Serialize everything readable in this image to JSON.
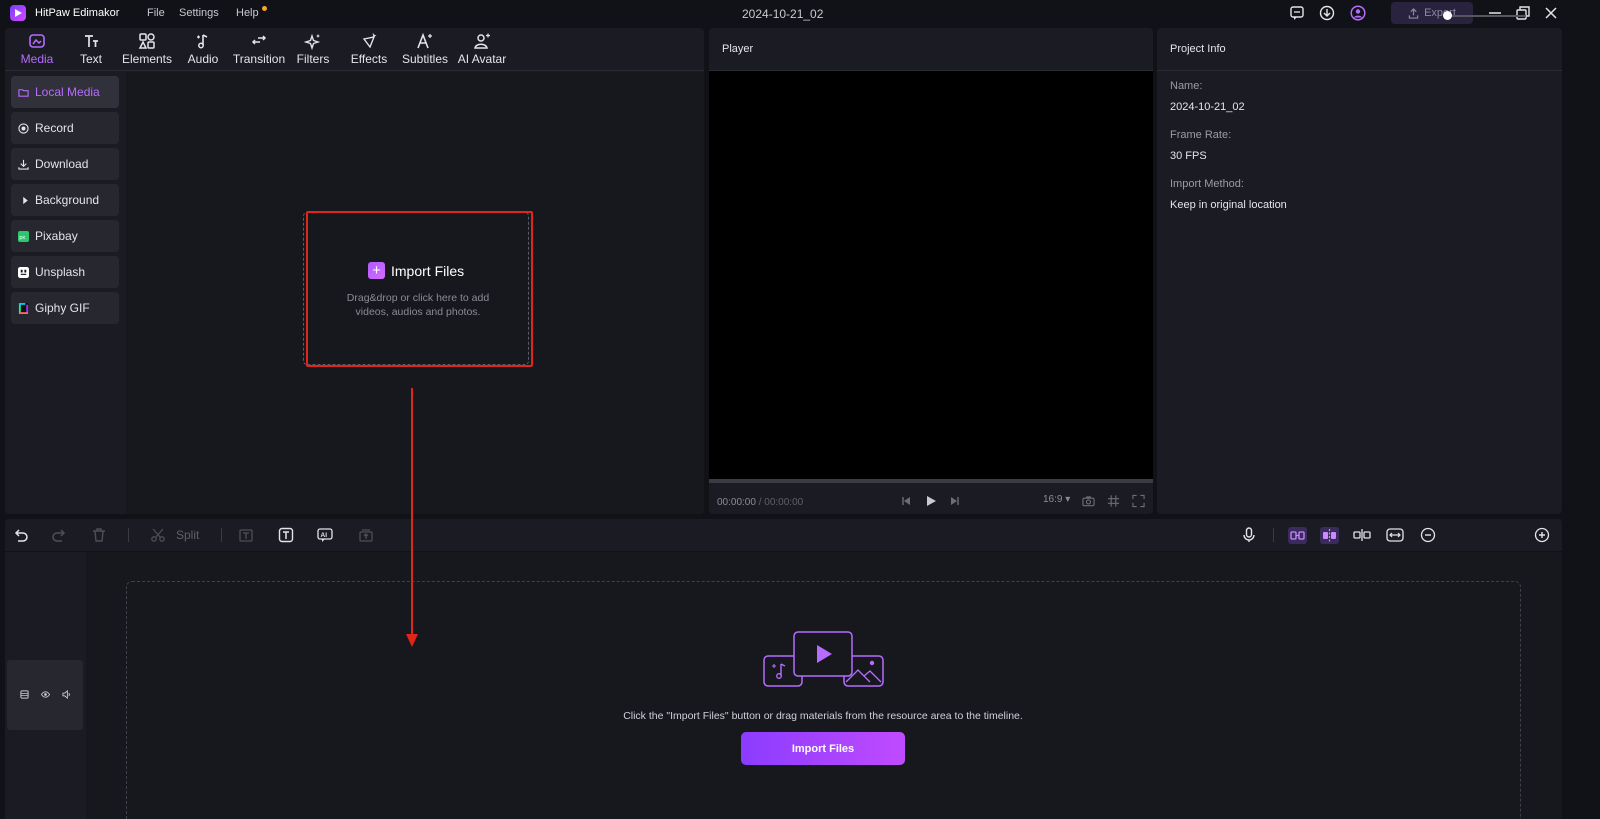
{
  "titlebar": {
    "app_name": "HitPaw Edimakor",
    "menu": [
      "File",
      "Settings",
      "Help"
    ],
    "document_title": "2024-10-21_02",
    "export_label": "Export"
  },
  "toolbar_tabs": [
    {
      "label": "Media",
      "icon": "media-icon",
      "active": true
    },
    {
      "label": "Text",
      "icon": "text-icon"
    },
    {
      "label": "Elements",
      "icon": "elements-icon"
    },
    {
      "label": "Audio",
      "icon": "audio-icon"
    },
    {
      "label": "Transition",
      "icon": "transition-icon"
    },
    {
      "label": "Filters",
      "icon": "filters-icon"
    },
    {
      "label": "Effects",
      "icon": "effects-icon"
    },
    {
      "label": "Subtitles",
      "icon": "subtitles-icon"
    },
    {
      "label": "AI Avatar",
      "icon": "ai-avatar-icon"
    }
  ],
  "sidebar": {
    "items": [
      {
        "label": "Local Media",
        "icon": "folder-icon",
        "active": true
      },
      {
        "label": "Record",
        "icon": "record-icon"
      },
      {
        "label": "Download",
        "icon": "download-icon"
      },
      {
        "label": "Background",
        "icon": "expand-triangle-icon"
      },
      {
        "label": "Pixabay",
        "icon": "pixabay-icon"
      },
      {
        "label": "Unsplash",
        "icon": "unsplash-icon"
      },
      {
        "label": "Giphy GIF",
        "icon": "giphy-icon"
      }
    ]
  },
  "media_import": {
    "title": "Import Files",
    "subtitle_line1": "Drag&drop or click here to add",
    "subtitle_line2": "videos, audios and photos."
  },
  "player": {
    "title": "Player",
    "current_time": "00:00:00",
    "separator": " / ",
    "total_time": "00:00:00",
    "aspect_ratio": "16:9"
  },
  "project_info": {
    "title": "Project Info",
    "fields": [
      {
        "label": "Name:",
        "value": "2024-10-21_02"
      },
      {
        "label": "Frame Rate:",
        "value": "30 FPS"
      },
      {
        "label": "Import Method:",
        "value": "Keep in original location"
      }
    ]
  },
  "timeline": {
    "split_label": "Split",
    "hint": "Click the \"Import Files\" button or drag materials from the resource area to the timeline.",
    "import_button": "Import Files"
  },
  "colors": {
    "accent": "#b66cff",
    "annotation_red": "#e0261b",
    "background": "#111218",
    "panel": "#1b1c23"
  }
}
